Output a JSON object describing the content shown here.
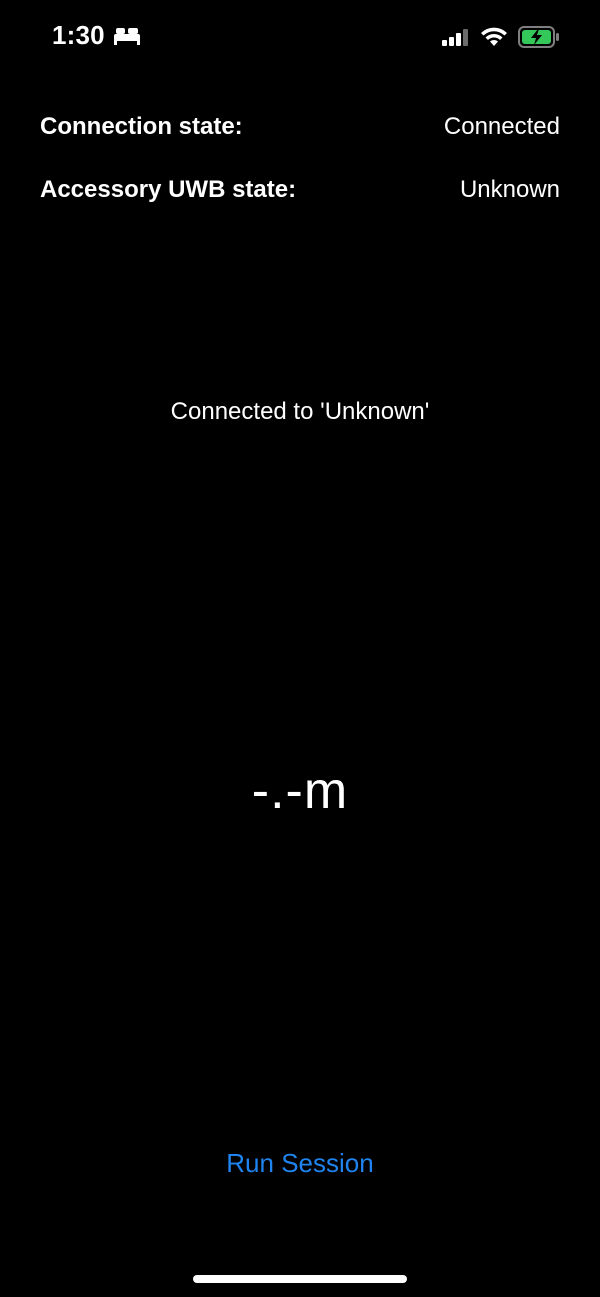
{
  "status_bar": {
    "time": "1:30",
    "focus_icon": "bed-icon",
    "signal_icon": "cellular-signal-icon",
    "wifi_icon": "wifi-icon",
    "battery_icon": "battery-charging-icon",
    "battery_color": "#34c759"
  },
  "connection": {
    "label": "Connection state:",
    "value": "Connected"
  },
  "accessory_uwb": {
    "label": "Accessory UWB state:",
    "value": "Unknown"
  },
  "message": {
    "text": "Connected to 'Unknown'"
  },
  "distance": {
    "text": "-.-m"
  },
  "actions": {
    "run_session_label": "Run Session",
    "accent_color": "#1f84f0"
  }
}
